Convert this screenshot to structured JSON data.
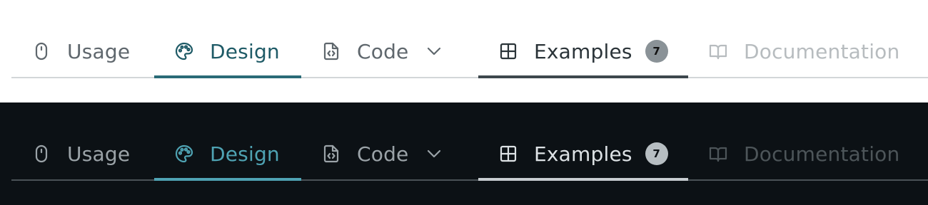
{
  "light": {
    "tabs": {
      "usage": "Usage",
      "design": "Design",
      "code": "Code",
      "examples": "Examples",
      "examples_badge": "7",
      "documentation": "Documentation"
    }
  },
  "dark": {
    "tabs": {
      "usage": "Usage",
      "design": "Design",
      "code": "Code",
      "examples": "Examples",
      "examples_badge": "7",
      "documentation": "Documentation"
    }
  },
  "icons": {
    "usage": "mouse-icon",
    "design": "palette-icon",
    "code": "code-file-icon",
    "code_dropdown": "chevron-down-icon",
    "examples": "grid-icon",
    "documentation": "book-icon"
  },
  "colors": {
    "light_accent": "#2a6b77",
    "dark_accent": "#4fa3b3",
    "light_bg": "#ffffff",
    "dark_bg": "#0c1115"
  }
}
